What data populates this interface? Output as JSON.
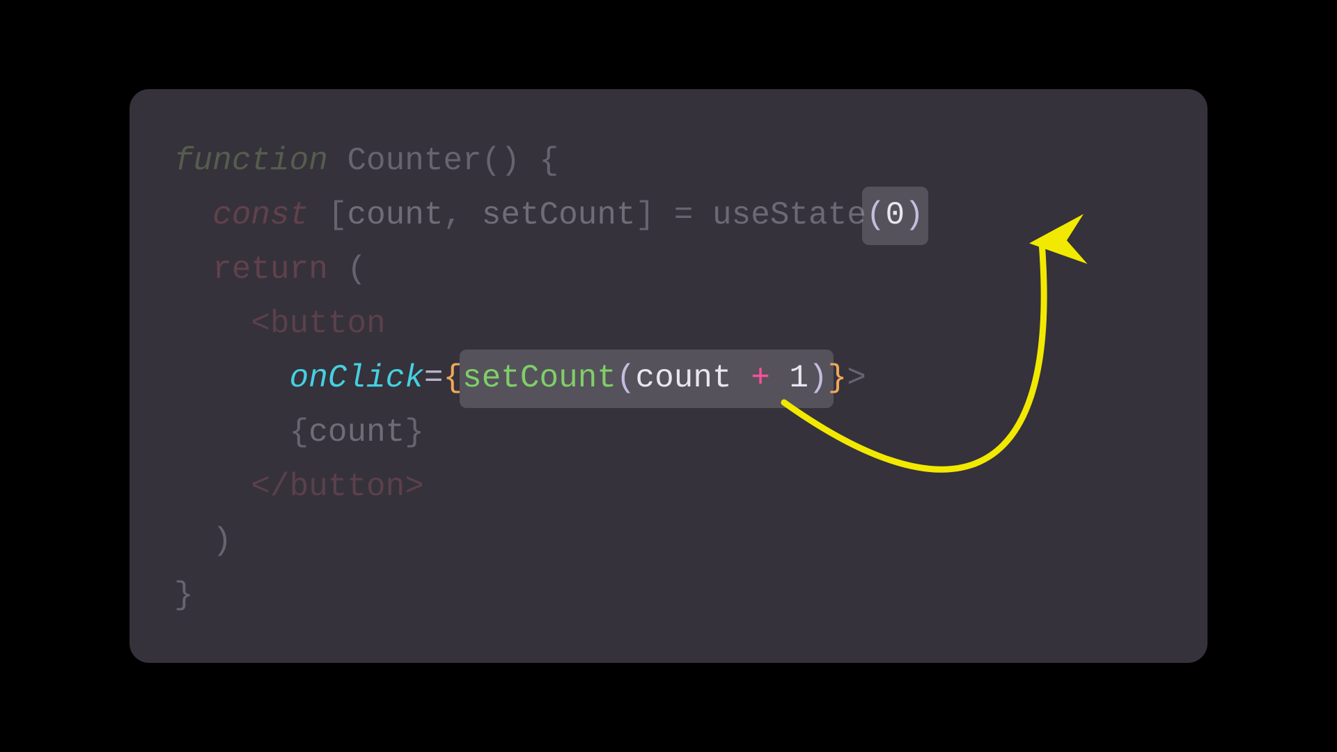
{
  "code": {
    "l1": {
      "fn": "function",
      "sp1": " ",
      "name": "Counter",
      "after": "() {"
    },
    "l2": {
      "indent": "  ",
      "const": "const",
      "sp1": " ",
      "open": "[",
      "a": "count",
      "comma": ", ",
      "b": "setCount",
      "close": "]",
      "sp2": " ",
      "eq": "=",
      "sp3": " ",
      "call": "useState",
      "paren_open": "(",
      "zero": "0",
      "paren_close": ")"
    },
    "l3": {
      "indent": "  ",
      "ret": "return",
      "sp": " ",
      "paren": "("
    },
    "l4": {
      "indent": "    ",
      "lt": "<",
      "tag": "button"
    },
    "l5": {
      "indent": "      ",
      "attr": "onClick",
      "eq": "=",
      "brace_open": "{",
      "fn": "setCount",
      "paren_open": "(",
      "a": "count",
      "sp1": " ",
      "op": "+",
      "sp2": " ",
      "one": "1",
      "paren_close": ")",
      "brace_close": "}",
      "gt": ">"
    },
    "l6": {
      "indent": "      ",
      "brace_open": "{",
      "a": "count",
      "brace_close": "}"
    },
    "l7": {
      "indent": "    ",
      "lt": "</",
      "tag": "button",
      "gt": ">"
    },
    "l8": {
      "indent": "  ",
      "paren": ")"
    },
    "l9": {
      "brace": "}"
    }
  },
  "colors": {
    "arrow": "#f2e900"
  }
}
